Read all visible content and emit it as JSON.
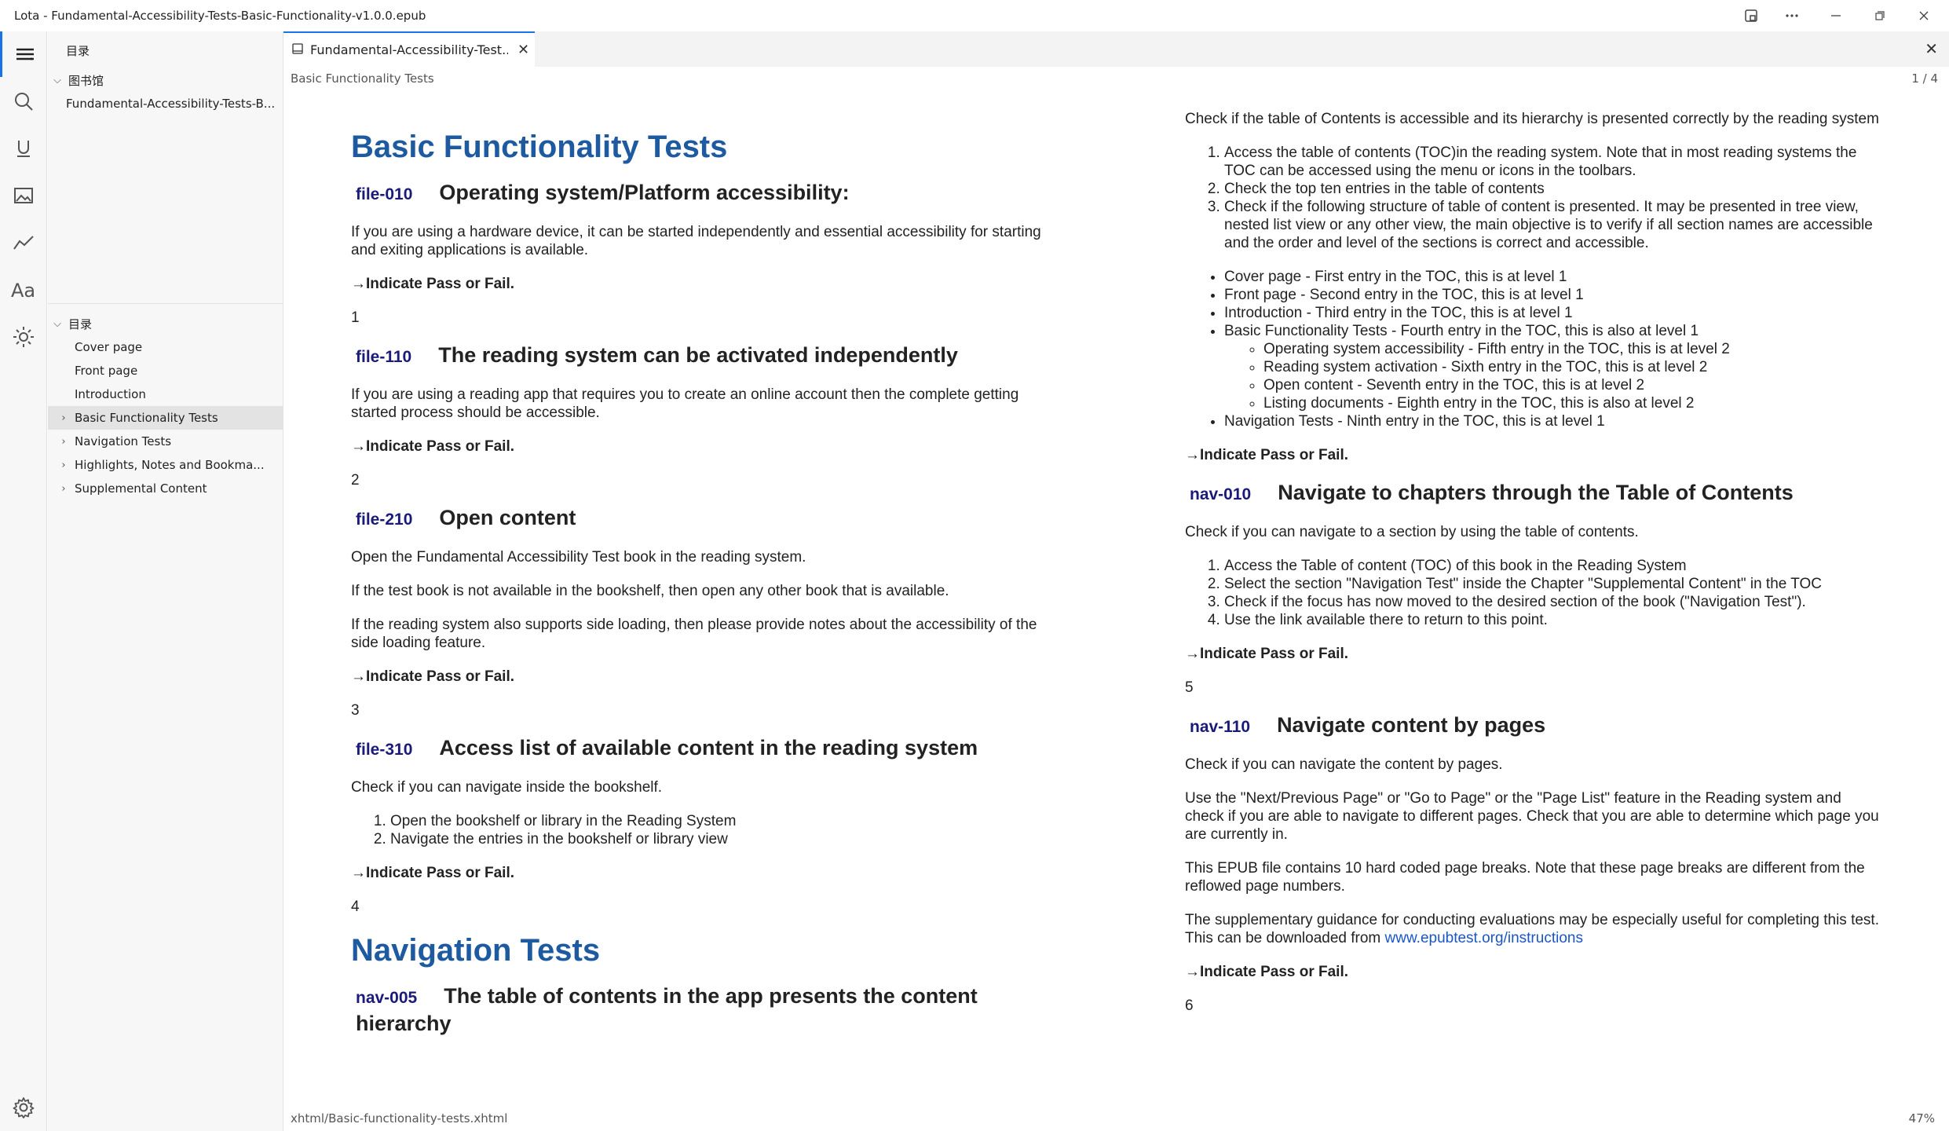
{
  "window": {
    "title": "Lota - Fundamental-Accessibility-Tests-Basic-Functionality-v1.0.0.epub"
  },
  "sidebar": {
    "header": "目录",
    "library_label": "图书馆",
    "library_item": "Fundamental-Accessibility-Tests-B...",
    "toc_label": "目录",
    "toc_items": [
      {
        "label": "Cover page"
      },
      {
        "label": "Front page"
      },
      {
        "label": "Introduction"
      },
      {
        "label": "Basic Functionality Tests"
      },
      {
        "label": "Navigation Tests"
      },
      {
        "label": "Highlights, Notes and Bookma..."
      },
      {
        "label": "Supplemental Content"
      }
    ]
  },
  "editor": {
    "tab_label": "Fundamental-Accessibility-Test...",
    "breadcrumb": "Basic Functionality Tests",
    "page_count": "1 / 4",
    "status_path": "xhtml/Basic-functionality-tests.xhtml",
    "zoom": "47%"
  },
  "content": {
    "left": {
      "h1": "Basic Functionality Tests",
      "s1": {
        "code": "file-010",
        "title": "Operating system/Platform accessibility:",
        "body": "If you are using a hardware device, it can be started independently and essential accessibility for starting and exiting applications is available.",
        "pf": "→Indicate Pass or Fail.",
        "num": "1"
      },
      "s2": {
        "code": "file-110",
        "title": "The reading system can be activated independently",
        "body": "If you are using a reading app that requires you to create an online account then the complete getting started process should be accessible.",
        "pf": "→Indicate Pass or Fail.",
        "num": "2"
      },
      "s3": {
        "code": "file-210",
        "title": "Open content",
        "p1": "Open the Fundamental Accessibility Test book in the reading system.",
        "p2": "If the test book is not available in the bookshelf, then open any other book that is available.",
        "p3": "If the reading system also supports side loading, then please provide notes about the accessibility of the side loading feature.",
        "pf": "→Indicate Pass or Fail.",
        "num": "3"
      },
      "s4": {
        "code": "file-310",
        "title": "Access list of available content in the reading system",
        "body": "Check if you can navigate inside the bookshelf.",
        "li1": "Open the bookshelf or library in the Reading System",
        "li2": "Navigate the entries in the bookshelf or library view",
        "pf": "→Indicate Pass or Fail.",
        "num": "4"
      },
      "h1b": "Navigation Tests",
      "s5": {
        "code": "nav-005",
        "title": "The table of contents in the app presents the content hierarchy"
      }
    },
    "right": {
      "intro": "Check if the table of Contents is accessible and its hierarchy is presented correctly by the reading system",
      "ol1": "Access the table of contents (TOC)in the reading system. Note that in most reading systems the TOC can be accessed using the menu or icons in the toolbars.",
      "ol2": "Check the top ten entries in the table of contents",
      "ol3": "Check if the following structure of table of content is presented. It may be presented in tree view, nested list view or any other view, the main objective is to verify if all section names are accessible and the order and level of the sections is correct and accessible.",
      "ul1": "Cover page - First entry in the TOC, this is at level 1",
      "ul2": "Front page - Second entry in the TOC, this is at level 1",
      "ul3": "Introduction - Third entry in the TOC, this is at level 1",
      "ul4": "Basic Functionality Tests - Fourth entry in the TOC, this is also at level 1",
      "sub1": "Operating system accessibility - Fifth entry in the TOC, this is at level 2",
      "sub2": "Reading system activation - Sixth entry in the TOC, this is at level 2",
      "sub3": "Open content - Seventh entry in the TOC, this is at level 2",
      "sub4": "Listing documents - Eighth entry in the TOC, this is also at level 2",
      "ul5": "Navigation Tests - Ninth entry in the TOC, this is at level 1",
      "pf1": "→Indicate Pass or Fail.",
      "s6": {
        "code": "nav-010",
        "title": "Navigate to chapters through the Table of Contents",
        "body": "Check if you can navigate to a section by using the table of contents.",
        "li1": "Access the Table of content (TOC) of this book in the Reading System",
        "li2": "Select the section \"Navigation Test\" inside the Chapter \"Supplemental Content\" in the TOC",
        "li3": "Check if the focus has now moved to the desired section of the book (\"Navigation Test\").",
        "li4": "Use the link available there to return to this point.",
        "pf": "→Indicate Pass or Fail.",
        "num": "5"
      },
      "s7": {
        "code": "nav-110",
        "title": "Navigate content by pages",
        "p1": "Check if you can navigate the content by pages.",
        "p2": "Use the \"Next/Previous Page\" or \"Go to Page\" or the \"Page List\" feature in the Reading system and check if you are able to navigate to different pages. Check that you are able to determine which page you are currently in.",
        "p3": "This EPUB file contains 10 hard coded page breaks. Note that these page breaks are different from the reflowed page numbers.",
        "p4a": "The supplementary guidance for conducting evaluations may be especially useful for completing this test. This can be downloaded from ",
        "link": "www.epubtest.org/instructions",
        "pf": "→Indicate Pass or Fail.",
        "num": "6"
      }
    }
  }
}
